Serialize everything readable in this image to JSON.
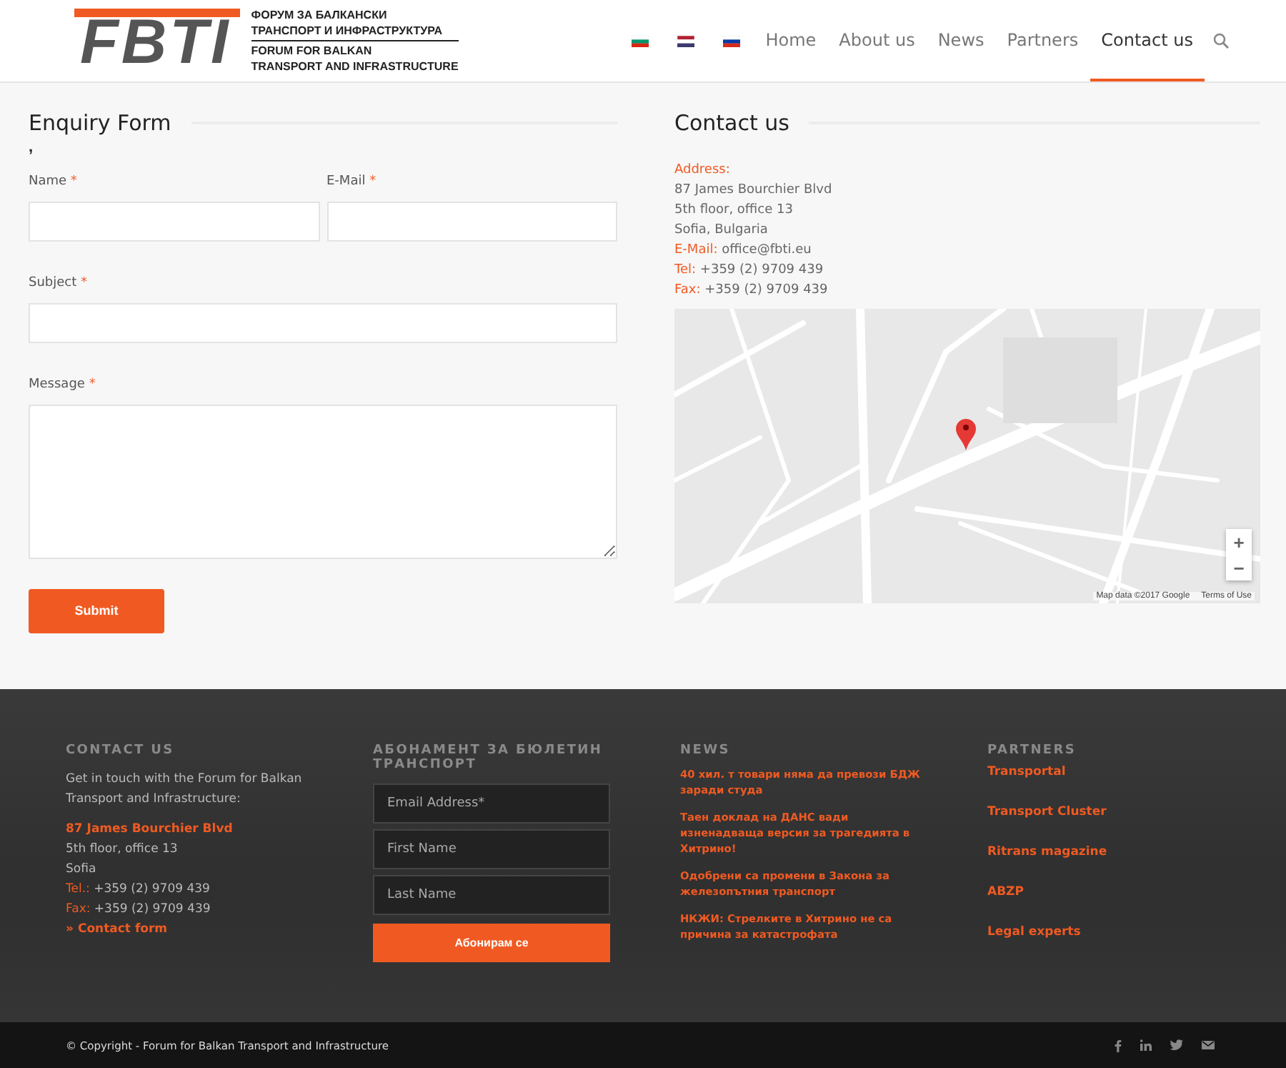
{
  "header": {
    "logo": {
      "mark": "FBTI",
      "lines": [
        "ФОРУМ ЗА БАЛКАНСКИ",
        "ТРАНСПОРТ И ИНФРАСТРУКТУРА",
        "FORUM FOR BALKAN",
        "TRANSPORT AND INFRASTRUCTURE"
      ]
    },
    "languages": [
      {
        "kind": "bulgaria"
      },
      {
        "kind": "usa"
      },
      {
        "kind": "russia"
      }
    ],
    "nav": [
      {
        "label": "Home",
        "selected": false
      },
      {
        "label": "About us",
        "selected": false
      },
      {
        "label": "News",
        "selected": false
      },
      {
        "label": "Partners",
        "selected": false
      },
      {
        "label": "Contact us",
        "selected": true
      }
    ]
  },
  "enquiry_form": {
    "title": "Enquiry Form",
    "note": ",",
    "fields": [
      {
        "kind": "half",
        "label": "Name",
        "required_marker": "*"
      },
      {
        "kind": "half",
        "label": "E-Mail",
        "required_marker": "*"
      },
      {
        "kind": "full",
        "label": "Subject",
        "required_marker": "*"
      },
      {
        "kind": "textarea",
        "label": "Message",
        "required_marker": "*"
      }
    ],
    "submit": "Submit"
  },
  "contact": {
    "title": "Contact us",
    "lines": [
      {
        "label": "Address:"
      },
      {
        "value": "87 James Bourchier Blvd"
      },
      {
        "value": "5th floor, office 13"
      },
      {
        "value": "Sofia, Bulgaria"
      },
      {
        "label": "E-Mail:",
        "value": "office@fbti.eu"
      },
      {
        "label": "Tel:",
        "value": "+359 (2) 9709 439"
      },
      {
        "label": "Fax:",
        "value": "+359 (2) 9709 439"
      }
    ],
    "map": {
      "zoom_in": "+",
      "zoom_out": "−",
      "attribution": "Map data ©2017 Google",
      "terms": "Terms of Use"
    }
  },
  "footer": {
    "contact": {
      "title": "CONTACT US",
      "intro": "Get in touch with the Forum for Balkan Transport and Infrastructure:",
      "lines": [
        {
          "kind": "link",
          "value": "87 James Bourchier Blvd"
        },
        {
          "kind": "text",
          "value": "5th floor, office 13"
        },
        {
          "kind": "text",
          "value": "Sofia"
        },
        {
          "kind": "labelled",
          "label": "Tel.:",
          "value": "+359 (2) 9709 439"
        },
        {
          "kind": "labelled",
          "label": "Fax:",
          "value": "+359 (2) 9709 439"
        },
        {
          "kind": "link",
          "value": "» Contact form"
        }
      ]
    },
    "newsletter": {
      "title": "АБОНАМЕНТ ЗА БЮЛЕТИН ТРАНСПОРТ",
      "fields": [
        {
          "placeholder": "Email Address*"
        },
        {
          "placeholder": "First Name"
        },
        {
          "placeholder": "Last Name"
        }
      ],
      "button": "Абонирам се"
    },
    "news": {
      "title": "NEWS",
      "items": [
        "40 хил. т товари няма да превози БДЖ заради студа",
        "Таен доклад на ДАНС вади изненадваща версия за трагедията в Хитрино!",
        "Одобрени са промени в Закона за железопътния транспорт",
        "НКЖИ: Стрелките в Хитрино не са причина за катастрофата"
      ]
    },
    "partners": {
      "title": "PARTNERS",
      "items": [
        "Transportal",
        "Transport Cluster",
        "Ritrans magazine",
        "ABZP",
        "Legal experts"
      ]
    }
  },
  "bottom_bar": {
    "copyright": "© Copyright - Forum for Balkan Transport and Infrastructure",
    "social": [
      {
        "kind": "facebook"
      },
      {
        "kind": "linkedin"
      },
      {
        "kind": "twitter"
      },
      {
        "kind": "mail"
      }
    ]
  }
}
